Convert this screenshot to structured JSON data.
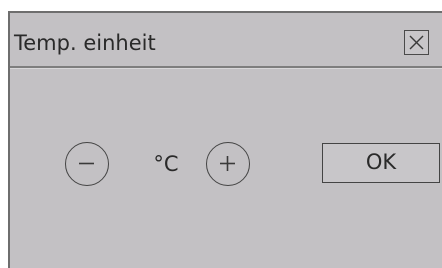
{
  "dialog": {
    "title": "Temp. einheit",
    "close_icon": "close-x-icon",
    "unit_value": "°C",
    "decrease_icon": "minus-circle-icon",
    "increase_icon": "plus-circle-icon",
    "ok_label": "OK"
  },
  "colors": {
    "dialog_background": "#c3c1c4",
    "text": "#2a2a2a",
    "outline": "#444444"
  }
}
